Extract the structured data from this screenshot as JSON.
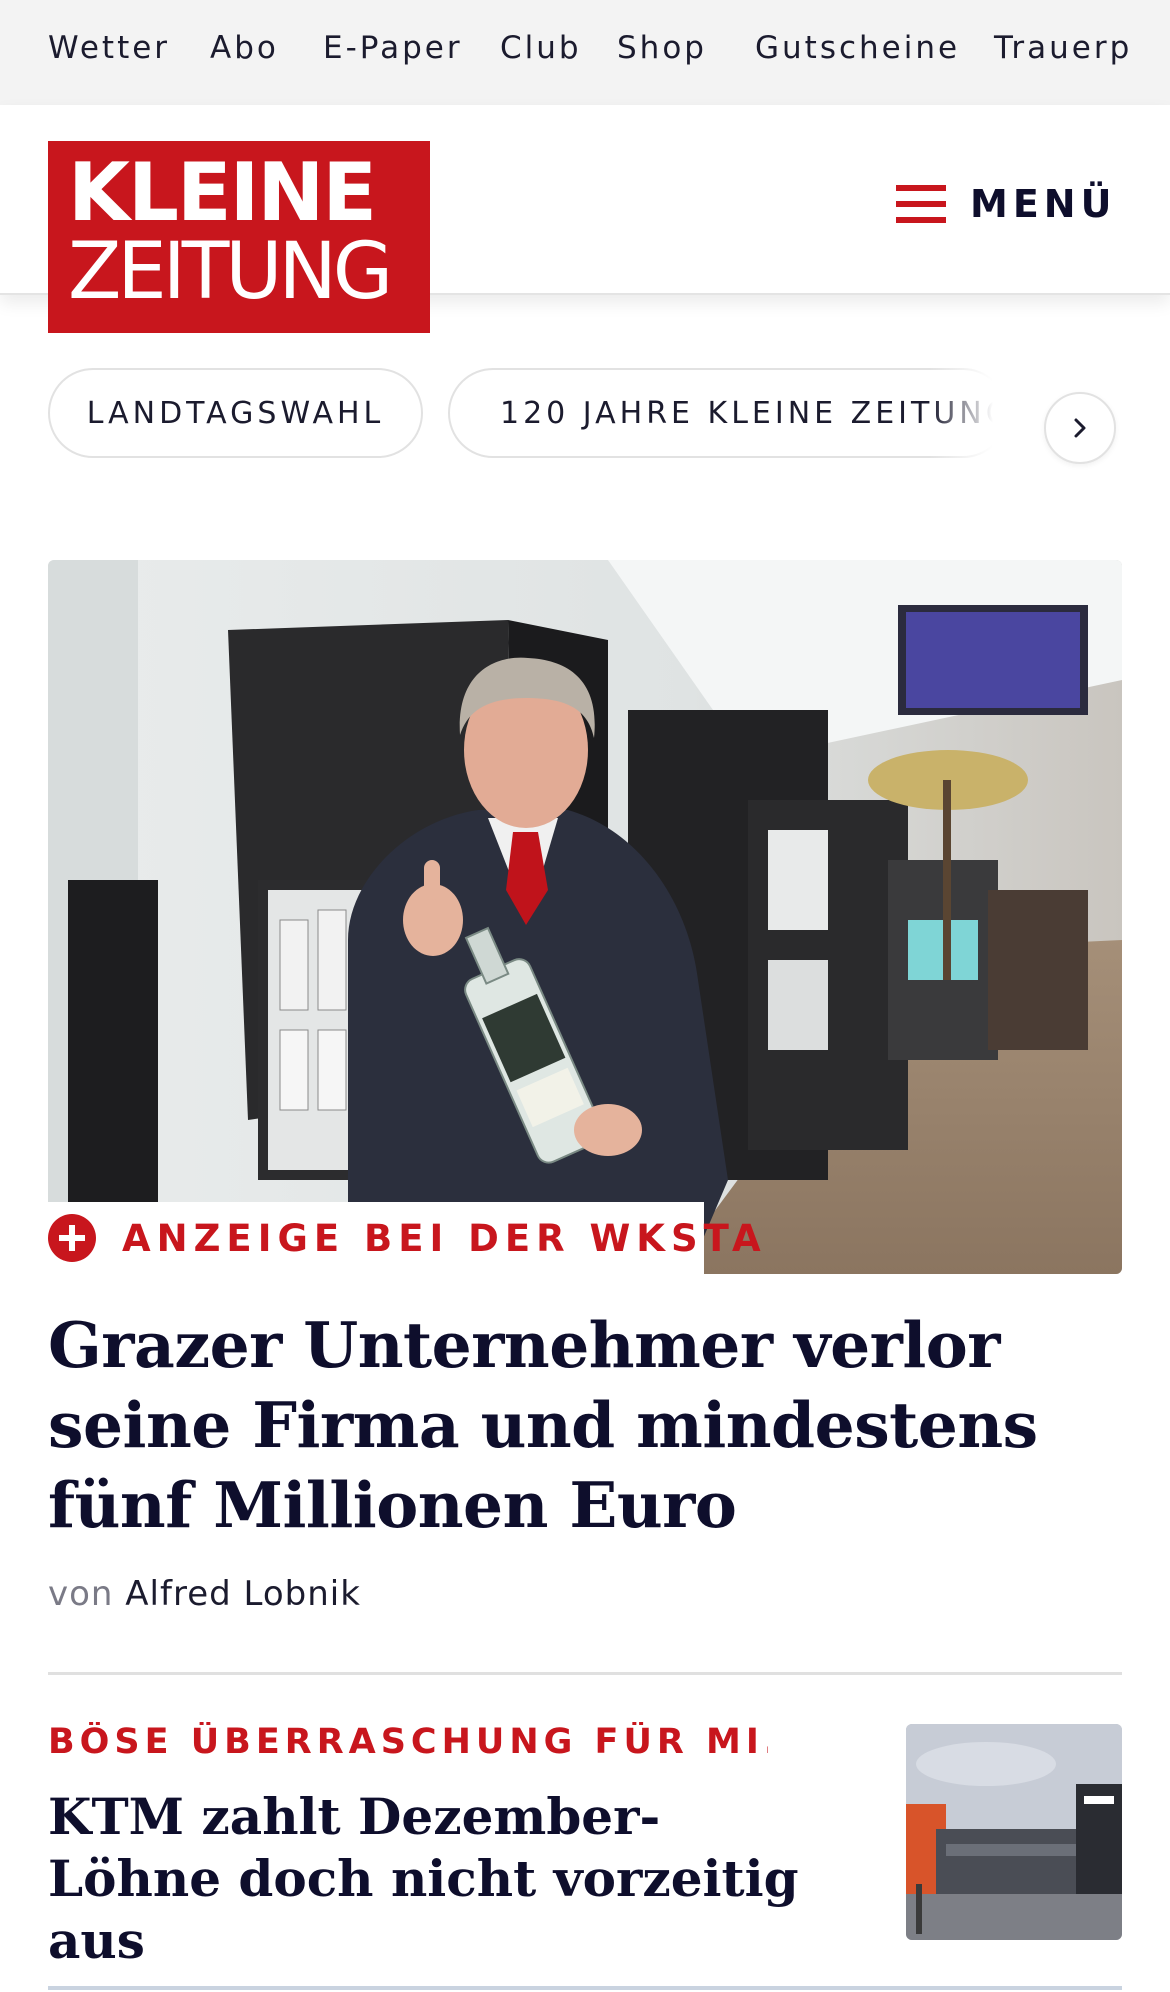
{
  "topbar": {
    "links": [
      "Wetter",
      "Abo",
      "E-Paper",
      "Club",
      "Shop",
      "Gutscheine",
      "Trauerp"
    ]
  },
  "header": {
    "logo_line1": "KLEINE",
    "logo_line2": "ZEITUNG",
    "menu_label": "MENÜ"
  },
  "chips": {
    "items": [
      "LANDTAGSWAHL",
      "120 JAHRE KLEINE ZEITUNG"
    ]
  },
  "hero": {
    "kicker": "ANZEIGE BEI DER WKSTA",
    "headline": "Grazer Unternehmer verlor seine Firma und mindestens fünf Millionen Euro",
    "byline_prefix": "von",
    "author": "Alfred Lobnik"
  },
  "article2": {
    "kicker": "BÖSE ÜBERRASCHUNG FÜR MI...",
    "headline": "KTM zahlt Dezember-Löhne doch nicht vorzeitig aus"
  },
  "colors": {
    "brand_red": "#c8161d",
    "text_dark": "#0e0e2c",
    "topbar_bg": "#f3f3f3"
  },
  "icons": [
    "hamburger-icon",
    "chevron-right-icon",
    "plus-circle-icon"
  ]
}
